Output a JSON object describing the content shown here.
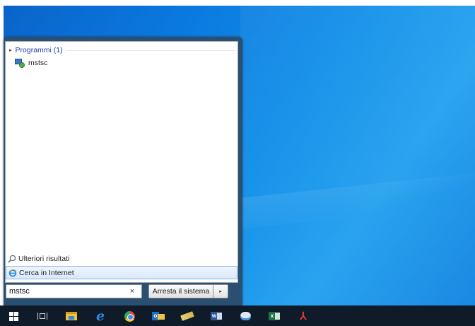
{
  "start_menu": {
    "group_header": "Programmi (1)",
    "results": [
      {
        "label": "mstsc",
        "icon": "remote-desktop-icon"
      }
    ],
    "more_results": "Ulteriori risultati",
    "search_internet": "Cerca in Internet",
    "search_value": "mstsc",
    "clear_glyph": "×",
    "shutdown_label": "Arresta il sistema",
    "shutdown_arrow_glyph": "▸",
    "group_arrow_glyph": "▸"
  },
  "taskbar": {
    "items": [
      {
        "name": "start-button",
        "icon": "windows-logo-icon"
      },
      {
        "name": "task-view-button",
        "icon": "task-view-icon"
      },
      {
        "name": "file-explorer-button",
        "icon": "folder-icon"
      },
      {
        "name": "internet-explorer-button",
        "icon": "internet-explorer-icon"
      },
      {
        "name": "chrome-button",
        "icon": "chrome-icon"
      },
      {
        "name": "outlook-button",
        "icon": "outlook-icon"
      },
      {
        "name": "pencil-app-button",
        "icon": "pencil-icon"
      },
      {
        "name": "word-button",
        "icon": "word-icon"
      },
      {
        "name": "cloud-app-button",
        "icon": "cloud-icon"
      },
      {
        "name": "excel-button",
        "icon": "excel-icon"
      },
      {
        "name": "acrobat-button",
        "icon": "acrobat-icon"
      }
    ],
    "ie_glyph": "e",
    "outlook_letter": "o",
    "word_letter": "w",
    "excel_letter": "x",
    "acrobat_glyph": "⅄"
  },
  "colors": {
    "desktop_blue": "#0a7ae0",
    "taskbar": "#101b29",
    "start_menu_frame": "#2b4f70",
    "group_header_text": "#1e3f9a",
    "highlight": "#d9e9fa"
  }
}
